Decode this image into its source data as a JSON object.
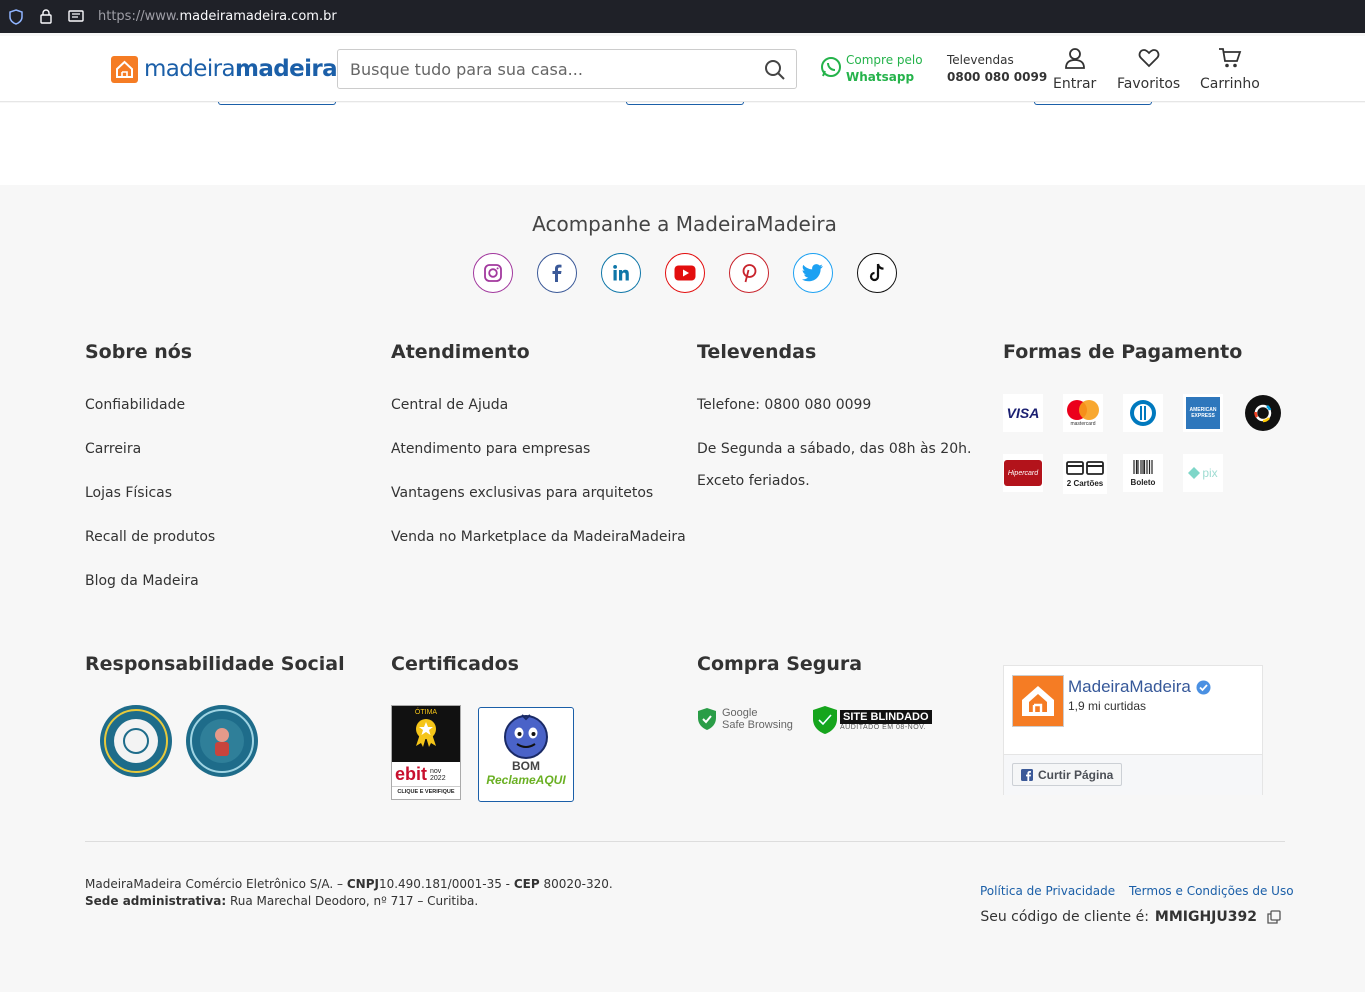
{
  "browser": {
    "url_proto": "https://www.",
    "url_host": "madeiramadeira.com.br",
    "icons": [
      "shield-icon",
      "lock-icon",
      "reader-icon"
    ]
  },
  "header": {
    "logo_regular": "madeira",
    "logo_bold": "madeira",
    "search_placeholder": "Busque tudo para sua casa...",
    "whatsapp_line1": "Compre pelo",
    "whatsapp_line2": "Whatsapp",
    "televendas_label": "Televendas",
    "televendas_phone": "0800 080 0099",
    "login": "Entrar",
    "favorites": "Favoritos",
    "cart": "Carrinho"
  },
  "social": {
    "title": "Acompanhe a MadeiraMadeira",
    "networks": [
      {
        "icon": "instagram-icon",
        "color": "#a2399e"
      },
      {
        "icon": "facebook-icon",
        "color": "#3b5998"
      },
      {
        "icon": "linkedin-icon",
        "color": "#0e76a8"
      },
      {
        "icon": "youtube-icon",
        "color": "#e30e0e"
      },
      {
        "icon": "pinterest-icon",
        "color": "#c8232c"
      },
      {
        "icon": "twitter-icon",
        "color": "#1da1f2"
      },
      {
        "icon": "tiktok-icon",
        "color": "#111111"
      }
    ]
  },
  "footer": {
    "sobre": {
      "title": "Sobre nós",
      "links": [
        "Confiabilidade",
        "Carreira",
        "Lojas Físicas",
        "Recall de produtos",
        "Blog da Madeira"
      ]
    },
    "atendimento": {
      "title": "Atendimento",
      "links": [
        "Central de Ajuda",
        "Atendimento para empresas",
        "Vantagens exclusivas para arquitetos",
        "Venda no Marketplace da MadeiraMadeira"
      ]
    },
    "televendas": {
      "title": "Televendas",
      "phone": "Telefone: 0800 080 0099",
      "hours": "De Segunda a sábado, das 08h às 20h.",
      "note": "Exceto feriados."
    },
    "pagamento": {
      "title": "Formas de Pagamento",
      "visa": "VISA",
      "mastercard": "mastercard",
      "amex": "AMERICAN EXPRESS",
      "hipercard": "Hipercard",
      "dois_cartoes": "2 Cartões",
      "boleto": "Boleto",
      "pix": "pix"
    },
    "social_resp": {
      "title": "Responsabilidade Social"
    },
    "certificados": {
      "title": "Certificados",
      "ebit_top": "ÓTIMA",
      "ebit_brand": "ebit",
      "ebit_date": "nov 2022",
      "ebit_cta": "CLIQUE E VERIFIQUE",
      "ra_level": "BOM",
      "ra_brand": "ReclameAQUI"
    },
    "compra_segura": {
      "title": "Compra Segura",
      "google_line1": "Google",
      "google_line2": "Safe Browsing",
      "blindado": "SITE BLINDADO",
      "blindado_sub": "AUDITADO EM 08-NOV."
    },
    "facebook": {
      "page": "MadeiraMadeira",
      "likes": "1,9 mi curtidas",
      "like_btn": "Curtir Página"
    }
  },
  "bottom": {
    "company": "MadeiraMadeira Comércio Eletrônico S/A. – ",
    "cnpj_label": "CNPJ",
    "cnpj": "10.490.181/0001-35 - ",
    "cep_label": "CEP",
    "cep": " 80020-320. ",
    "sede_label": "Sede administrativa:",
    "address": " Rua Marechal Deodoro, nº 717 – Curitiba.",
    "privacy": "Política de Privacidade",
    "terms": "Termos e Condições de Uso",
    "client_label": "Seu código de cliente é:",
    "client_code": "MMIGHJU392"
  },
  "colors": {
    "brand_blue": "#1b5fa8",
    "brand_orange": "#f57c24",
    "whatsapp_green": "#25b34b"
  }
}
